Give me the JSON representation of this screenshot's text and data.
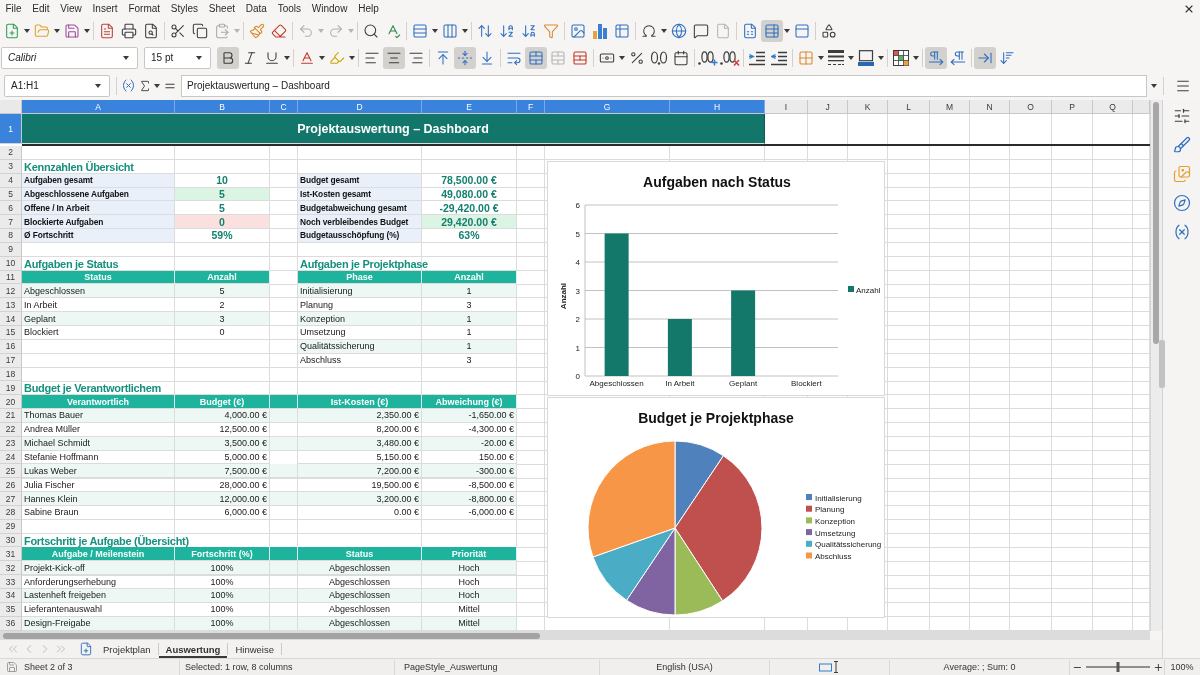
{
  "menu_bar": {
    "items": [
      "File",
      "Edit",
      "View",
      "Insert",
      "Format",
      "Styles",
      "Sheet",
      "Data",
      "Tools",
      "Window",
      "Help"
    ]
  },
  "standard_toolbar": {
    "freeze_on": true
  },
  "formatting_toolbar": {
    "font_name": "Calibri",
    "font_size": "15 pt",
    "bold": true,
    "italic": false,
    "underline": false,
    "align_left": false,
    "align_center": true,
    "align_right": false,
    "align_top": false,
    "align_middle": true,
    "align_bottom": false,
    "merge_and_center": true,
    "left_to_right": true,
    "right_to_left": false,
    "text_horizontal": true,
    "text_vertical": false
  },
  "formula_bar": {
    "name_box": "A1:H1",
    "content": "Projektauswertung – Dashboard"
  },
  "column_headers": [
    {
      "label": "A",
      "selected": true
    },
    {
      "label": "B",
      "selected": true
    },
    {
      "label": "C",
      "selected": true
    },
    {
      "label": "D",
      "selected": true
    },
    {
      "label": "E",
      "selected": true
    },
    {
      "label": "F",
      "selected": true
    },
    {
      "label": "G",
      "selected": true
    },
    {
      "label": "H",
      "selected": true
    },
    {
      "label": "I",
      "selected": false
    },
    {
      "label": "J",
      "selected": false
    },
    {
      "label": "K",
      "selected": false
    },
    {
      "label": "L",
      "selected": false
    },
    {
      "label": "M",
      "selected": false
    },
    {
      "label": "N",
      "selected": false
    },
    {
      "label": "O",
      "selected": false
    },
    {
      "label": "P",
      "selected": false
    },
    {
      "label": "Q",
      "selected": false
    }
  ],
  "row_headers": [
    {
      "label": "1",
      "selected": true
    },
    {
      "label": "2",
      "selected": false
    },
    {
      "label": "3",
      "selected": false
    },
    {
      "label": "4",
      "selected": false
    },
    {
      "label": "5",
      "selected": false
    },
    {
      "label": "6",
      "selected": false
    },
    {
      "label": "7",
      "selected": false
    },
    {
      "label": "8",
      "selected": false
    },
    {
      "label": "9",
      "selected": false
    },
    {
      "label": "10",
      "selected": false
    },
    {
      "label": "11",
      "selected": false
    },
    {
      "label": "12",
      "selected": false
    },
    {
      "label": "13",
      "selected": false
    },
    {
      "label": "14",
      "selected": false
    },
    {
      "label": "15",
      "selected": false
    },
    {
      "label": "16",
      "selected": false
    },
    {
      "label": "17",
      "selected": false
    },
    {
      "label": "18",
      "selected": false
    },
    {
      "label": "19",
      "selected": false
    },
    {
      "label": "20",
      "selected": false
    },
    {
      "label": "21",
      "selected": false
    },
    {
      "label": "22",
      "selected": false
    },
    {
      "label": "23",
      "selected": false
    },
    {
      "label": "24",
      "selected": false
    },
    {
      "label": "25",
      "selected": false
    },
    {
      "label": "26",
      "selected": false
    },
    {
      "label": "27",
      "selected": false
    },
    {
      "label": "28",
      "selected": false
    },
    {
      "label": "29",
      "selected": false
    },
    {
      "label": "30",
      "selected": false
    },
    {
      "label": "31",
      "selected": false
    },
    {
      "label": "32",
      "selected": false
    },
    {
      "label": "33",
      "selected": false
    },
    {
      "label": "34",
      "selected": false
    },
    {
      "label": "35",
      "selected": false
    },
    {
      "label": "36",
      "selected": false
    }
  ],
  "sheet": {
    "title": "Projektauswertung – Dashboard",
    "kpi_section": {
      "heading": "Kennzahlen Übersicht",
      "left": [
        {
          "label": "Aufgaben gesamt",
          "value": "10",
          "color": "#ffffff"
        },
        {
          "label": "Abgeschlossene Aufgaben",
          "value": "5",
          "color": "#dcf4e3"
        },
        {
          "label": "Offene / In Arbeit",
          "value": "5",
          "color": "#ffffff"
        },
        {
          "label": "Blockierte Aufgaben",
          "value": "0",
          "color": "#fbe0e0"
        },
        {
          "label": "Ø Fortschritt",
          "value": "59%",
          "color": "#ffffff"
        }
      ],
      "right": [
        {
          "label": "Budget gesamt",
          "value": "78,500.00 €",
          "color": "#ffffff"
        },
        {
          "label": "Ist-Kosten gesamt",
          "value": "49,080.00 €",
          "color": "#ffffff"
        },
        {
          "label": "Budgetabweichung gesamt",
          "value": "-29,420.00 €",
          "color": "#ffffff"
        },
        {
          "label": "Noch verbleibendes Budget",
          "value": "29,420.00 €",
          "color": "#dcf4e3"
        },
        {
          "label": "Budgetausschöpfung (%)",
          "value": "63%",
          "color": "#ffffff"
        }
      ]
    },
    "status_table": {
      "heading": "Aufgaben je Status",
      "columns": [
        "Status",
        "Anzahl"
      ],
      "rows": [
        [
          "Abgeschlossen",
          "5"
        ],
        [
          "In Arbeit",
          "2"
        ],
        [
          "Geplant",
          "3"
        ],
        [
          "Blockiert",
          "0"
        ]
      ]
    },
    "phase_table": {
      "heading": "Aufgaben je Projektphase",
      "columns": [
        "Phase",
        "Anzahl"
      ],
      "rows": [
        [
          "Initialisierung",
          "1"
        ],
        [
          "Planung",
          "3"
        ],
        [
          "Konzeption",
          "1"
        ],
        [
          "Umsetzung",
          "1"
        ],
        [
          "Qualitätssicherung",
          "1"
        ],
        [
          "Abschluss",
          "3"
        ]
      ]
    },
    "budget_table": {
      "heading": "Budget je Verantwortlichem",
      "columns": [
        "Verantwortlich",
        "Budget (€)",
        "Ist-Kosten (€)",
        "Abweichung (€)"
      ],
      "rows": [
        [
          "Thomas Bauer",
          "4,000.00 €",
          "2,350.00 €",
          "-1,650.00 €"
        ],
        [
          "Andrea Müller",
          "12,500.00 €",
          "8,200.00 €",
          "-4,300.00 €"
        ],
        [
          "Michael Schmidt",
          "3,500.00 €",
          "3,480.00 €",
          "-20.00 €"
        ],
        [
          "Stefanie Hoffmann",
          "5,000.00 €",
          "5,150.00 €",
          "150.00 €"
        ],
        [
          "Lukas Weber",
          "7,500.00 €",
          "7,200.00 €",
          "-300.00 €"
        ],
        [
          "Julia Fischer",
          "28,000.00 €",
          "19,500.00 €",
          "-8,500.00 €"
        ],
        [
          "Hannes Klein",
          "12,000.00 €",
          "3,200.00 €",
          "-8,800.00 €"
        ],
        [
          "Sabine Braun",
          "6,000.00 €",
          "0.00 €",
          "-6,000.00 €"
        ]
      ]
    },
    "progress_table": {
      "heading": "Fortschritt je Aufgabe (Übersicht)",
      "columns": [
        "Aufgabe / Meilenstein",
        "Fortschritt (%)",
        "Status",
        "Priorität"
      ],
      "rows": [
        [
          "Projekt-Kick-off",
          "100%",
          "Abgeschlossen",
          "Hoch"
        ],
        [
          "Anforderungserhebung",
          "100%",
          "Abgeschlossen",
          "Hoch"
        ],
        [
          "Lastenheft freigeben",
          "100%",
          "Abgeschlossen",
          "Hoch"
        ],
        [
          "Lieferantenauswahl",
          "100%",
          "Abgeschlossen",
          "Mittel"
        ],
        [
          "Design-Freigabe",
          "100%",
          "Abgeschlossen",
          "Mittel"
        ]
      ]
    }
  },
  "status_chart": {
    "chart_data": {
      "type": "bar",
      "title": "Aufgaben nach Status",
      "ylabel": "Anzahl",
      "categories": [
        "Abgeschlossen",
        "In Arbeit",
        "Geplant",
        "Blockiert"
      ],
      "series": [
        {
          "name": "Anzahl",
          "color": "#13776a",
          "values": [
            5,
            2,
            3,
            0
          ]
        }
      ],
      "ylim": [
        0,
        6
      ],
      "yticks": [
        0,
        1,
        2,
        3,
        4,
        5,
        6
      ],
      "grid": true,
      "legend": "right"
    }
  },
  "budget_chart": {
    "chart_data": {
      "type": "pie",
      "title": "Budget je Projektphase",
      "categories": [
        "Initialisierung",
        "Planung",
        "Konzeption",
        "Umsetzung",
        "Qualitätssicherung",
        "Abschluss"
      ],
      "series": [
        {
          "colors": [
            "#4f81bd",
            "#c0504d",
            "#9bbb59",
            "#8064a2",
            "#4bacc6",
            "#f79646"
          ],
          "values": [
            9.4,
            31.4,
            9.2,
            9.4,
            10.2,
            30.4
          ]
        }
      ],
      "legend": "right"
    }
  },
  "sheet_tabs": [
    {
      "label": "Projektplan",
      "selected": false
    },
    {
      "label": "Auswertung",
      "selected": true
    },
    {
      "label": "Hinweise",
      "selected": false
    }
  ],
  "status_bar": {
    "sheet_position": "Sheet 2 of 3",
    "selection": "Selected: 1 row, 8 columns",
    "page_style": "PageStyle_Auswertung",
    "language": "English (USA)",
    "summary": "Average: ; Sum: 0",
    "zoom_slider": {
      "level": 0.5
    },
    "zoom": "100%"
  }
}
